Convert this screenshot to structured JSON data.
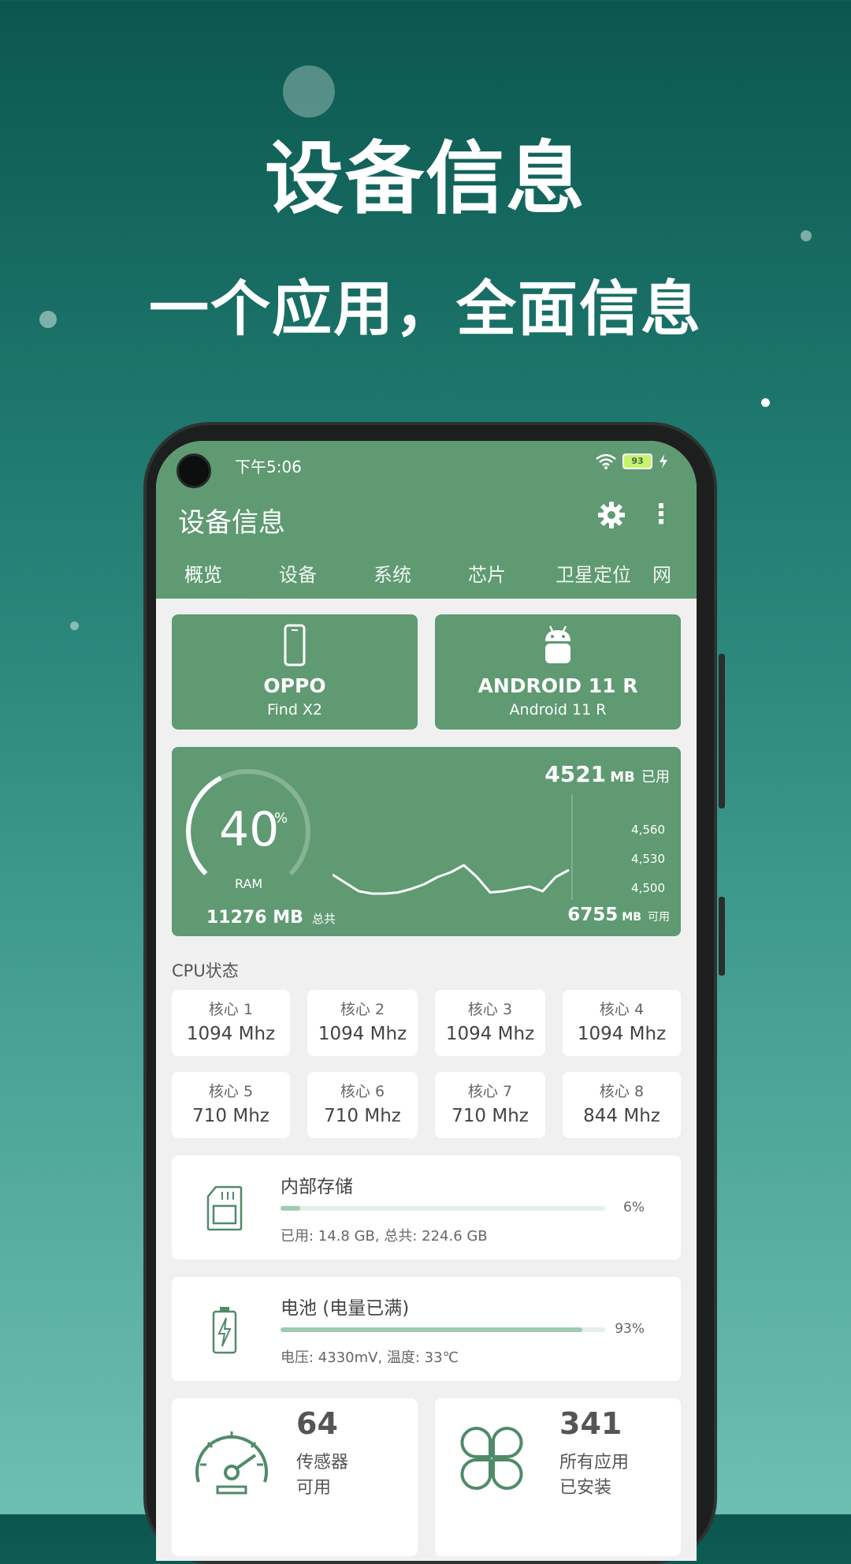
{
  "hero": {
    "title": "设备信息",
    "subtitle": "一个应用，全面信息"
  },
  "status_bar": {
    "time": "下午5:06",
    "battery": "93"
  },
  "app_bar": {
    "title": "设备信息"
  },
  "tabs": [
    {
      "label": "概览",
      "active": true
    },
    {
      "label": "设备"
    },
    {
      "label": "系统"
    },
    {
      "label": "芯片"
    },
    {
      "label": "卫星定位"
    },
    {
      "label": "网"
    }
  ],
  "device": {
    "brand": "OPPO",
    "model": "Find X2"
  },
  "os": {
    "name": "ANDROID 11 R",
    "version": "Android 11 R"
  },
  "ram": {
    "percent": "40",
    "percent_sign": "%",
    "label": "RAM",
    "used_value": "4521",
    "used_unit": "MB",
    "used_label": "已用",
    "total_value": "11276 MB",
    "total_label": "总共",
    "available_value": "6755",
    "available_unit": "MB",
    "available_label": "可用",
    "axis_ticks": [
      "4,560",
      "4,530",
      "4,500"
    ],
    "history": [
      4512,
      4505,
      4498,
      4496,
      4496,
      4497,
      4500,
      4504,
      4510,
      4514,
      4520,
      4510,
      4497,
      4498,
      4500,
      4502,
      4498,
      4510,
      4516
    ]
  },
  "cpu": {
    "section_label": "CPU状态",
    "cores": [
      {
        "label": "核心 1",
        "value": "1094 Mhz"
      },
      {
        "label": "核心 2",
        "value": "1094 Mhz"
      },
      {
        "label": "核心 3",
        "value": "1094 Mhz"
      },
      {
        "label": "核心 4",
        "value": "1094 Mhz"
      },
      {
        "label": "核心 5",
        "value": "710 Mhz"
      },
      {
        "label": "核心 6",
        "value": "710 Mhz"
      },
      {
        "label": "核心 7",
        "value": "710 Mhz"
      },
      {
        "label": "核心 8",
        "value": "844 Mhz"
      }
    ]
  },
  "storage": {
    "title": "内部存储",
    "percent": 6,
    "percent_text": "6%",
    "info": "已用: 14.8 GB,  总共: 224.6 GB"
  },
  "battery": {
    "title": "电池 (电量已满)",
    "percent": 93,
    "percent_text": "93%",
    "info": "电压: 4330mV,  温度: 33℃"
  },
  "sensors": {
    "count": "64",
    "line1": "传感器",
    "line2": "可用"
  },
  "apps": {
    "count": "341",
    "line1": "所有应用",
    "line2": "已安装"
  },
  "colors": {
    "green": "#5f9a72",
    "bar": "#9fcbb0"
  }
}
